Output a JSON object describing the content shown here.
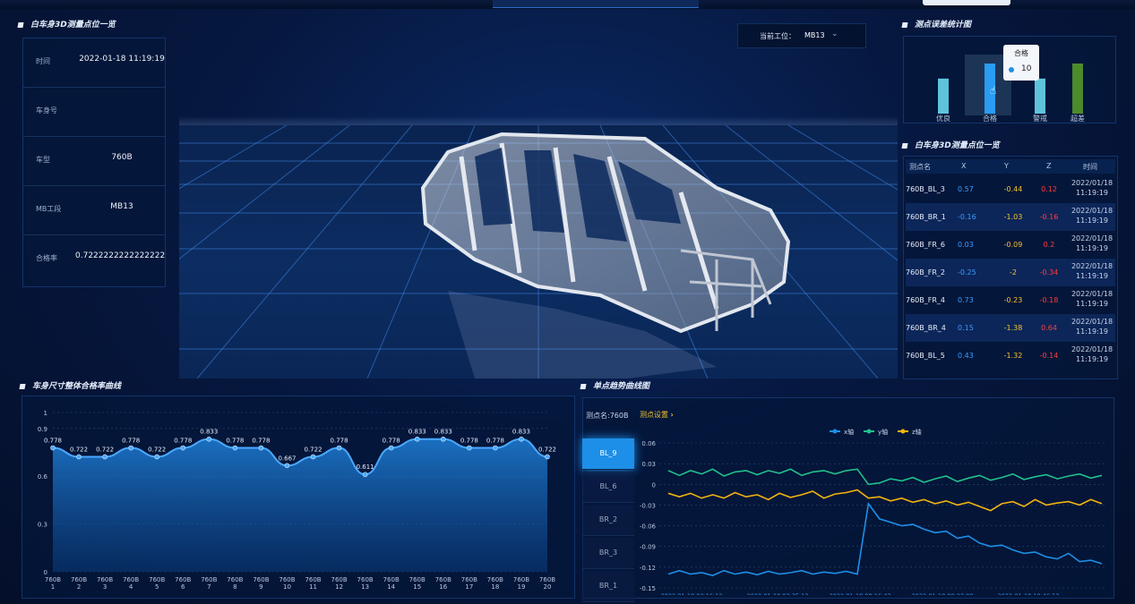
{
  "info_panel": {
    "title": "白车身3D测量点位一览",
    "rows": [
      {
        "key": "时间",
        "value": "2022-01-18 11:19:19"
      },
      {
        "key": "车身号",
        "value": ""
      },
      {
        "key": "车型",
        "value": "760B"
      },
      {
        "key": "MB工段",
        "value": "MB13"
      },
      {
        "key": "合格率",
        "value": "0.7222222222222222"
      }
    ]
  },
  "station_selector": {
    "label": "当前工位：",
    "value": "MB13"
  },
  "stats_panel": {
    "title": "测点误差统计图",
    "tooltip": {
      "title": "合格",
      "value": "10"
    },
    "chart_data": {
      "type": "bar",
      "categories": [
        "优良",
        "合格",
        "警戒",
        "超差"
      ],
      "values": [
        7,
        10,
        7,
        10
      ],
      "colors": [
        "#5ec3da",
        "#2a9cf2",
        "#5ec3da",
        "#4d8a2c"
      ]
    }
  },
  "table_panel": {
    "title": "白车身3D测量点位一览",
    "headers": [
      "测点名",
      "X",
      "Y",
      "Z",
      "时间"
    ],
    "rows": [
      {
        "id": "760B_BL_3",
        "x": "0.57",
        "y": "-0.44",
        "z": "0.12",
        "t1": "2022/01/18",
        "t2": "11:19:19"
      },
      {
        "id": "760B_BR_1",
        "x": "-0.16",
        "y": "-1.03",
        "z": "-0.16",
        "t1": "2022/01/18",
        "t2": "11:19:19"
      },
      {
        "id": "760B_FR_6",
        "x": "0.03",
        "y": "-0.09",
        "z": "0.2",
        "t1": "2022/01/18",
        "t2": "11:19:19"
      },
      {
        "id": "760B_FR_2",
        "x": "-0.25",
        "y": "-2",
        "z": "-0.34",
        "t1": "2022/01/18",
        "t2": "11:19:19"
      },
      {
        "id": "760B_FR_4",
        "x": "0.73",
        "y": "-0.23",
        "z": "-0.18",
        "t1": "2022/01/18",
        "t2": "11:19:19"
      },
      {
        "id": "760B_BR_4",
        "x": "0.15",
        "y": "-1.38",
        "z": "0.64",
        "t1": "2022/01/18",
        "t2": "11:19:19"
      },
      {
        "id": "760B_BL_5",
        "x": "0.43",
        "y": "-1.32",
        "z": "-0.14",
        "t1": "2022/01/18",
        "t2": "11:19:19"
      }
    ]
  },
  "pass_rate_panel": {
    "title": "车身尺寸整体合格率曲线",
    "chart_data": {
      "type": "area",
      "x": [
        "760B 1",
        "760B 2",
        "760B 3",
        "760B 4",
        "760B 5",
        "760B 6",
        "760B 7",
        "760B 8",
        "760B 9",
        "760B 10",
        "760B 11",
        "760B 12",
        "760B 13",
        "760B 14",
        "760B 15",
        "760B 16",
        "760B 17",
        "760B 18",
        "760B 19",
        "760B 20"
      ],
      "values": [
        0.778,
        0.722,
        0.722,
        0.778,
        0.722,
        0.778,
        0.833,
        0.778,
        0.778,
        0.667,
        0.722,
        0.778,
        0.611,
        0.778,
        0.833,
        0.833,
        0.778,
        0.778,
        0.833,
        0.722
      ],
      "labels": [
        "0.778",
        "0.722",
        "0.722",
        "0.778",
        "0.722",
        "0.778",
        "0.833",
        "0.778",
        "0.778",
        "0.667",
        "0.722",
        "0.778",
        "0.611",
        "0.778",
        "0.833",
        "0.833",
        "0.778",
        "0.778",
        "0.833",
        "0.722"
      ],
      "ylim": [
        0,
        1
      ],
      "yticks": [
        "1",
        "0.9",
        "0.6",
        "0.3",
        "0"
      ],
      "color": "#1e7fd8"
    }
  },
  "trend_panel": {
    "title": "单点趋势曲线图",
    "point_label": "测点名:760B",
    "setting_link": "测点设置",
    "tabs": [
      "BL_9",
      "BL_6",
      "BR_2",
      "BR_3",
      "BR_1"
    ],
    "active_tab": 0,
    "chart_data": {
      "type": "line",
      "legend": [
        "x轴",
        "y轴",
        "z轴"
      ],
      "colors": [
        "#1e8fe6",
        "#21c08b",
        "#f2b40f"
      ],
      "yticks": [
        "0.06",
        "0.03",
        "0",
        "-0.03",
        "-0.06",
        "-0.09",
        "-0.12",
        "-0.15"
      ],
      "ylim": [
        -0.15,
        0.06
      ],
      "xticks": [
        "2022-01-18 02:16:12",
        "2022-01-18 03:35:13",
        "2022-01-18 08:16:43",
        "2022-01-18 09:23:09",
        "2022-01-18 10:46:12"
      ],
      "series": [
        {
          "name": "x轴",
          "values": [
            -0.13,
            -0.125,
            -0.13,
            -0.128,
            -0.132,
            -0.125,
            -0.13,
            -0.127,
            -0.131,
            -0.126,
            -0.13,
            -0.128,
            -0.125,
            -0.13,
            -0.127,
            -0.129,
            -0.126,
            -0.13,
            -0.028,
            -0.05,
            -0.055,
            -0.06,
            -0.058,
            -0.065,
            -0.07,
            -0.068,
            -0.078,
            -0.075,
            -0.085,
            -0.09,
            -0.088,
            -0.095,
            -0.1,
            -0.098,
            -0.105,
            -0.108,
            -0.1,
            -0.112,
            -0.11,
            -0.115
          ]
        },
        {
          "name": "y轴",
          "values": [
            0.02,
            0.013,
            0.02,
            0.015,
            0.022,
            0.012,
            0.018,
            0.02,
            0.014,
            0.02,
            0.016,
            0.022,
            0.013,
            0.018,
            0.02,
            0.015,
            0.02,
            0.022,
            0.0,
            0.002,
            0.008,
            0.005,
            0.01,
            0.003,
            0.008,
            0.012,
            0.004,
            0.009,
            0.013,
            0.006,
            0.01,
            0.015,
            0.007,
            0.011,
            0.014,
            0.008,
            0.012,
            0.015,
            0.009,
            0.013
          ]
        },
        {
          "name": "z轴",
          "values": [
            -0.013,
            -0.018,
            -0.013,
            -0.02,
            -0.015,
            -0.02,
            -0.012,
            -0.018,
            -0.015,
            -0.022,
            -0.013,
            -0.019,
            -0.015,
            -0.01,
            -0.02,
            -0.014,
            -0.012,
            -0.008,
            -0.02,
            -0.018,
            -0.024,
            -0.02,
            -0.026,
            -0.022,
            -0.028,
            -0.024,
            -0.03,
            -0.026,
            -0.032,
            -0.038,
            -0.028,
            -0.025,
            -0.032,
            -0.022,
            -0.03,
            -0.027,
            -0.025,
            -0.03,
            -0.022,
            -0.028
          ]
        }
      ]
    }
  }
}
